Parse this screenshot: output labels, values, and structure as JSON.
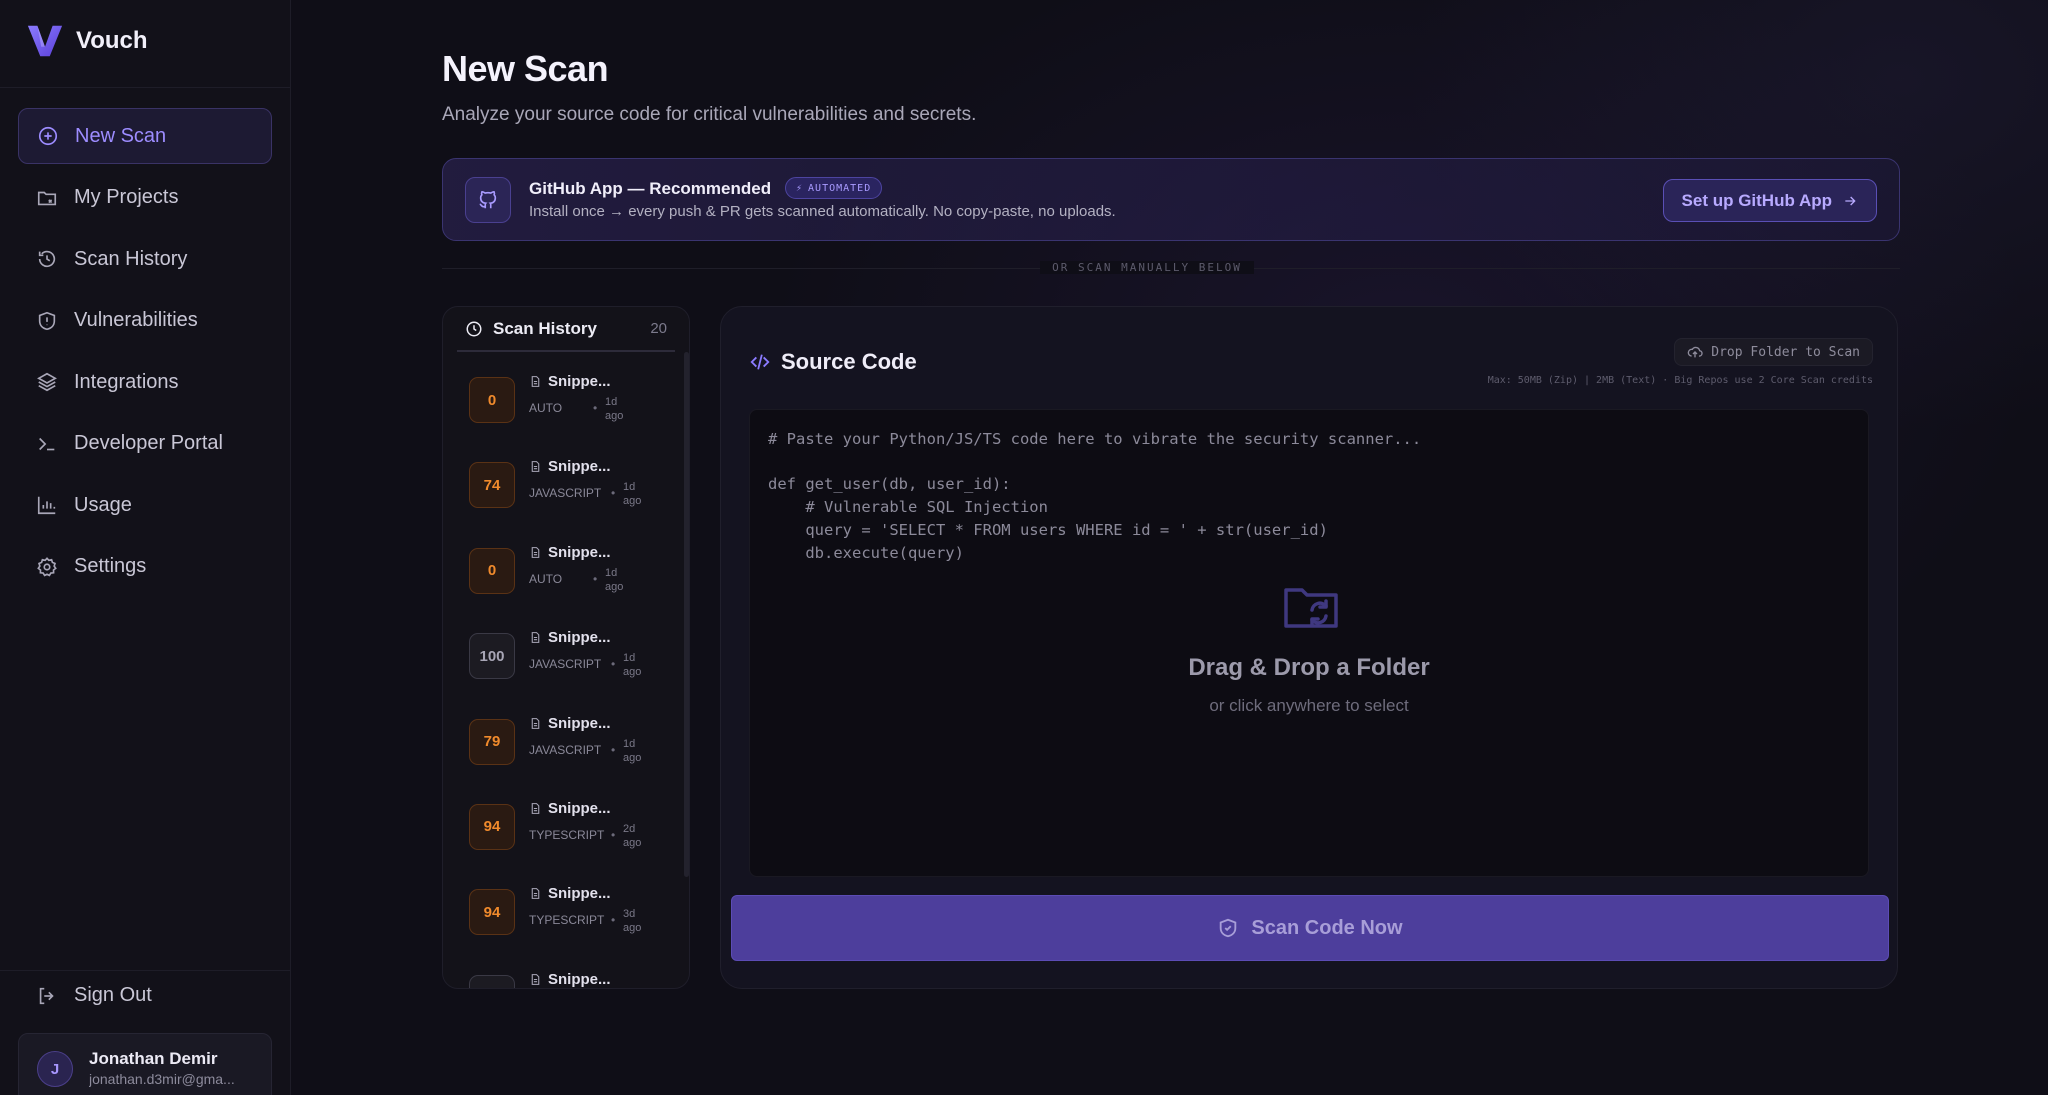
{
  "brand": {
    "name": "Vouch"
  },
  "nav": {
    "items": [
      {
        "label": "New Scan",
        "icon": "plus-circle-icon",
        "active": true
      },
      {
        "label": "My Projects",
        "icon": "folder-icon"
      },
      {
        "label": "Scan History",
        "icon": "history-icon"
      },
      {
        "label": "Vulnerabilities",
        "icon": "shield-alert-icon"
      },
      {
        "label": "Integrations",
        "icon": "layers-icon"
      },
      {
        "label": "Developer Portal",
        "icon": "terminal-icon"
      },
      {
        "label": "Usage",
        "icon": "bar-chart-icon"
      },
      {
        "label": "Settings",
        "icon": "gear-icon"
      }
    ],
    "sign_out": "Sign Out"
  },
  "user": {
    "initial": "J",
    "name": "Jonathan Demir",
    "email": "jonathan.d3mir@gma..."
  },
  "page": {
    "title": "New Scan",
    "subtitle": "Analyze your source code for critical vulnerabilities and secrets."
  },
  "github_banner": {
    "title": "GitHub App — Recommended",
    "badge": "AUTOMATED",
    "description": "Install once → every push & PR gets scanned automatically. No copy-paste, no uploads.",
    "button": "Set up GitHub App"
  },
  "divider_text": "OR SCAN MANUALLY BELOW",
  "history": {
    "title": "Scan History",
    "count": "20",
    "items": [
      {
        "score": "0",
        "tone": "orange",
        "name": "Snippe...",
        "lang": "AUTO",
        "time": "1d ago"
      },
      {
        "score": "74",
        "tone": "orange",
        "name": "Snippe...",
        "lang": "JAVASCRIPT",
        "time": "1d ago"
      },
      {
        "score": "0",
        "tone": "orange",
        "name": "Snippe...",
        "lang": "AUTO",
        "time": "1d ago"
      },
      {
        "score": "100",
        "tone": "gray",
        "name": "Snippe...",
        "lang": "JAVASCRIPT",
        "time": "1d ago"
      },
      {
        "score": "79",
        "tone": "orange",
        "name": "Snippe...",
        "lang": "JAVASCRIPT",
        "time": "1d ago"
      },
      {
        "score": "94",
        "tone": "orange",
        "name": "Snippe...",
        "lang": "TYPESCRIPT",
        "time": "2d ago"
      },
      {
        "score": "94",
        "tone": "orange",
        "name": "Snippe...",
        "lang": "TYPESCRIPT",
        "time": "3d ago"
      },
      {
        "score": "",
        "tone": "gray",
        "name": "Snippe...",
        "lang": "",
        "time": ""
      }
    ]
  },
  "source": {
    "title": "Source Code",
    "drop_button": "Drop Folder to Scan",
    "limits": "Max: 50MB (Zip) | 2MB (Text) · Big Repos use 2 Core Scan credits",
    "code": "# Paste your Python/JS/TS code here to vibrate the security scanner...\n\ndef get_user(db, user_id):\n    # Vulnerable SQL Injection\n    query = 'SELECT * FROM users WHERE id = ' + str(user_id)\n    db.execute(query)",
    "drop_title": "Drag & Drop a Folder",
    "drop_subtitle": "or click anywhere to select",
    "scan_button": "Scan Code Now"
  },
  "colors": {
    "accent": "#9d8cff",
    "scan_button": "#4d3e9c",
    "score_orange": "#f08a2c"
  }
}
